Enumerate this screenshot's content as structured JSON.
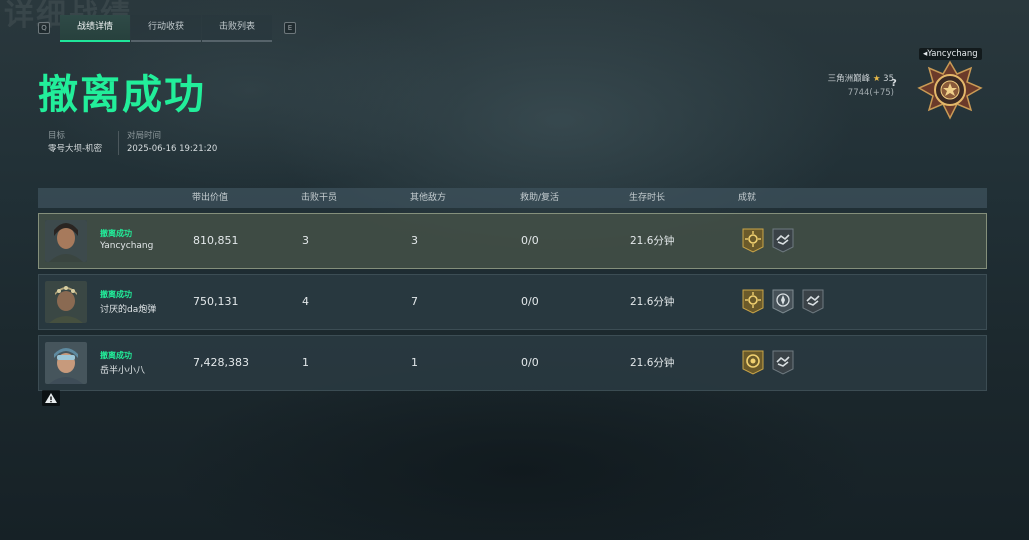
{
  "window": {
    "bg_ghost_title": "详细战绩"
  },
  "keys": {
    "left": "Q",
    "right": "E"
  },
  "tabs": [
    "战绩详情",
    "行动收获",
    "击败列表"
  ],
  "result": {
    "title": "撤离成功"
  },
  "meta": {
    "target_label": "目标",
    "target_value": "零号大坝-机密",
    "time_label": "对局时间",
    "time_value": "2025-06-16 19:21:20"
  },
  "rank": {
    "name": "三角洲巅峰",
    "stars": "35",
    "score": "7744(+75)",
    "help": "?",
    "player": "Yancychang"
  },
  "table": {
    "headers": [
      "带出价值",
      "击败干员",
      "其他敌方",
      "救助/复活",
      "生存时长",
      "成就"
    ],
    "rows": [
      {
        "status": "撤离成功",
        "name": "Yancychang",
        "value": "810,851",
        "kills": "3",
        "others": "3",
        "assist": "0/0",
        "time": "21.6分钟",
        "achievements": [
          "gold-sun-badge",
          "gray-handshake-badge"
        ]
      },
      {
        "status": "撤离成功",
        "name": "讨厌的da炮弹",
        "value": "750,131",
        "kills": "4",
        "others": "7",
        "assist": "0/0",
        "time": "21.6分钟",
        "achievements": [
          "gold-sun-badge",
          "gray-compass-badge",
          "gray-handshake-badge"
        ]
      },
      {
        "status": "撤离成功",
        "name": "岳半小小八",
        "value": "7,428,383",
        "kills": "1",
        "others": "1",
        "assist": "0/0",
        "time": "21.6分钟",
        "achievements": [
          "gold-medal-badge",
          "gray-handshake-badge"
        ]
      }
    ]
  },
  "colors": {
    "accent": "#22ee9a",
    "gold": "#e8b948",
    "bg": "#1d2a30"
  }
}
